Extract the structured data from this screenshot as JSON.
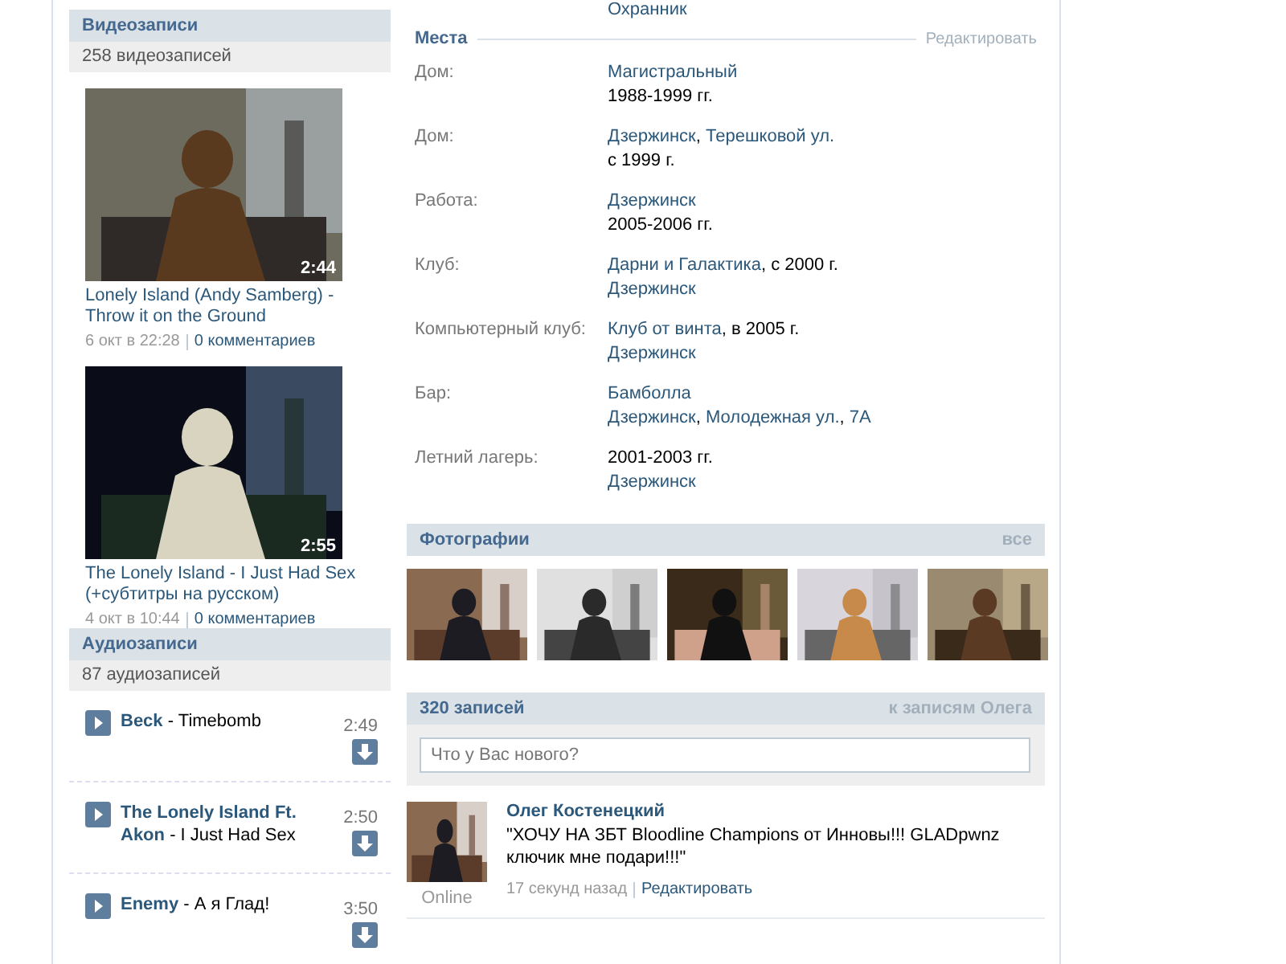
{
  "videos": {
    "title": "Видеозаписи",
    "count": "258 видеозаписей",
    "items": [
      {
        "kind": "picture",
        "duration": "2:44",
        "title": "Lonely Island (Andy Samberg) - Throw it on the Ground",
        "date": "6 окт в 22:28",
        "comments": "0 комментариев"
      },
      {
        "kind": "picture",
        "duration": "2:55",
        "title": "The Lonely Island - I Just Had Sex (+субтитры на русском)",
        "date": "4 окт в 10:44",
        "comments": "0 комментариев"
      }
    ]
  },
  "audio": {
    "title": "Аудиозаписи",
    "count": "87 аудиозаписей",
    "items": [
      {
        "artist": "Beck",
        "separator": "-",
        "title": "Timebomb",
        "duration": "2:49"
      },
      {
        "artist": "The Lonely Island Ft. Akon",
        "separator": "-",
        "title": "I Just Had Sex",
        "duration": "2:50"
      },
      {
        "artist": "Enemy",
        "separator": "-",
        "title": "А я Глад!",
        "duration": "3:50"
      }
    ]
  },
  "top_line": "Охранник",
  "places": {
    "title": "Места",
    "edit": "Редактировать",
    "rows": [
      {
        "label": "Дом:",
        "lines": [
          [
            {
              "text": "Магистральный",
              "link": true
            }
          ],
          [
            {
              "text": "1988-1999 гг.",
              "link": false
            }
          ]
        ]
      },
      {
        "label": "Дом:",
        "lines": [
          [
            {
              "text": "Дзержинск",
              "link": true
            },
            {
              "text": ", ",
              "link": false
            },
            {
              "text": "Терешковой ул.",
              "link": true
            }
          ],
          [
            {
              "text": "с 1999 г.",
              "link": false
            }
          ]
        ]
      },
      {
        "label": "Работа:",
        "lines": [
          [
            {
              "text": "Дзержинск",
              "link": true
            }
          ],
          [
            {
              "text": "2005-2006 гг.",
              "link": false
            }
          ]
        ]
      },
      {
        "label": "Клуб:",
        "lines": [
          [
            {
              "text": "Дарни и Галактика",
              "link": true
            },
            {
              "text": ", с 2000 г.",
              "link": false
            }
          ],
          [
            {
              "text": "Дзержинск",
              "link": true
            }
          ]
        ]
      },
      {
        "label": "Компьютерный клуб:",
        "lines": [
          [
            {
              "text": "Клуб от винта",
              "link": true
            },
            {
              "text": ", в 2005 г.",
              "link": false
            }
          ],
          [
            {
              "text": "Дзержинск",
              "link": true
            }
          ]
        ]
      },
      {
        "label": "Бар:",
        "lines": [
          [
            {
              "text": "Бамболла",
              "link": true
            }
          ],
          [
            {
              "text": "Дзержинск",
              "link": true
            },
            {
              "text": ", ",
              "link": false
            },
            {
              "text": "Молодежная ул.",
              "link": true
            },
            {
              "text": ", ",
              "link": false
            },
            {
              "text": "7А",
              "link": true
            }
          ]
        ]
      },
      {
        "label": "Летний лагерь:",
        "lines": [
          [
            {
              "text": "2001-2003 гг.",
              "link": false
            }
          ],
          [
            {
              "text": "Дзержинск",
              "link": true
            }
          ]
        ]
      }
    ]
  },
  "photos": {
    "title": "Фотографии",
    "all": "все"
  },
  "wall": {
    "title": "320 записей",
    "link": "к записям Олега",
    "placeholder": "Что у Вас нового?",
    "post": {
      "author": "Олег Костенецкий",
      "status": "Online",
      "text": "\"ХОЧУ НА ЗБТ Bloodline Champions от Инновы!!! GLADpwnz ключик мне подари!!!\"",
      "time": "17 секунд назад",
      "edit": "Редактировать"
    }
  }
}
